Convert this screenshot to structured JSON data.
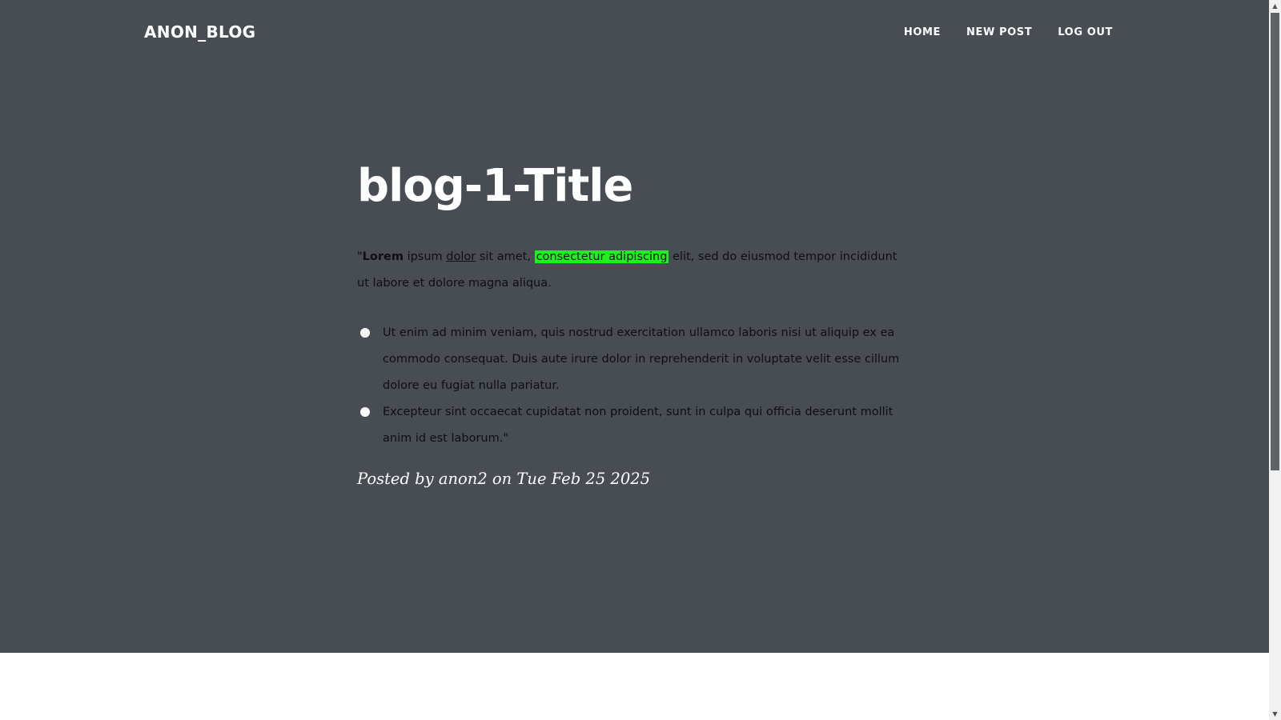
{
  "navbar": {
    "brand": "ANON_BLOG",
    "links": [
      "HOME",
      "NEW POST",
      "LOG OUT"
    ]
  },
  "post": {
    "title": "blog-1-Title",
    "paragraph": {
      "open_quote": "\"",
      "bold": "Lorem",
      "text1": " ipsum ",
      "underlined": "dolor",
      "text2": " sit amet, ",
      "highlighted": "consectetur adipiscing",
      "text3": " elit, sed do eiusmod tempor incididunt ut labore et dolore magna aliqua."
    },
    "list_items": [
      "Ut enim ad minim veniam, quis nostrud exercitation ullamco laboris nisi ut aliquip ex ea commodo consequat. Duis aute irure dolor in reprehenderit in voluptate velit esse cillum dolore eu fugiat nulla pariatur.",
      "Excepteur sint occaecat cupidatat non proident, sunt in culpa qui officia deserunt mollit anim id est laborum.\""
    ],
    "meta": "Posted by anon2 on Tue Feb 25 2025"
  },
  "colors": {
    "header_bg": "#484c53",
    "highlight": "#1cf21c"
  },
  "scrollbar": {
    "up_icon": "arrow-up",
    "down_icon": "arrow-down"
  }
}
